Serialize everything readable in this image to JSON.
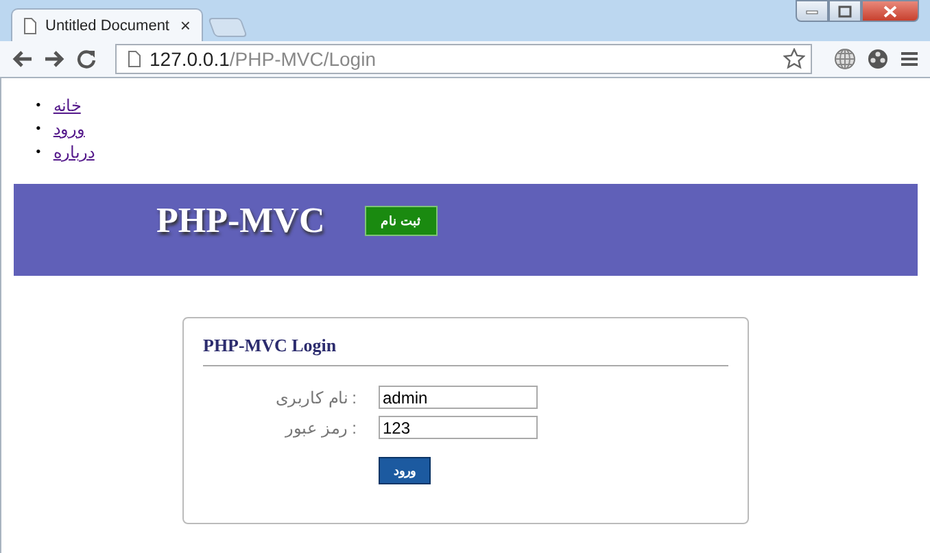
{
  "browser": {
    "tab_title": "Untitled Document",
    "close_glyph": "×",
    "url_host": "127.0.0.1",
    "url_path": "/PHP-MVC/Login"
  },
  "nav": [
    {
      "marker": "•",
      "label": "خانه"
    },
    {
      "marker": "•",
      "label": "ورود"
    },
    {
      "marker": "•",
      "label": "درباره"
    }
  ],
  "header": {
    "title": "PHP-MVC",
    "button": "ثبت نام"
  },
  "login": {
    "title": "PHP-MVC Login",
    "fields": [
      {
        "label": "نام کاربری :",
        "value": "admin"
      },
      {
        "label": "رمز عبور :",
        "value": "123"
      }
    ],
    "submit": "ورود"
  }
}
